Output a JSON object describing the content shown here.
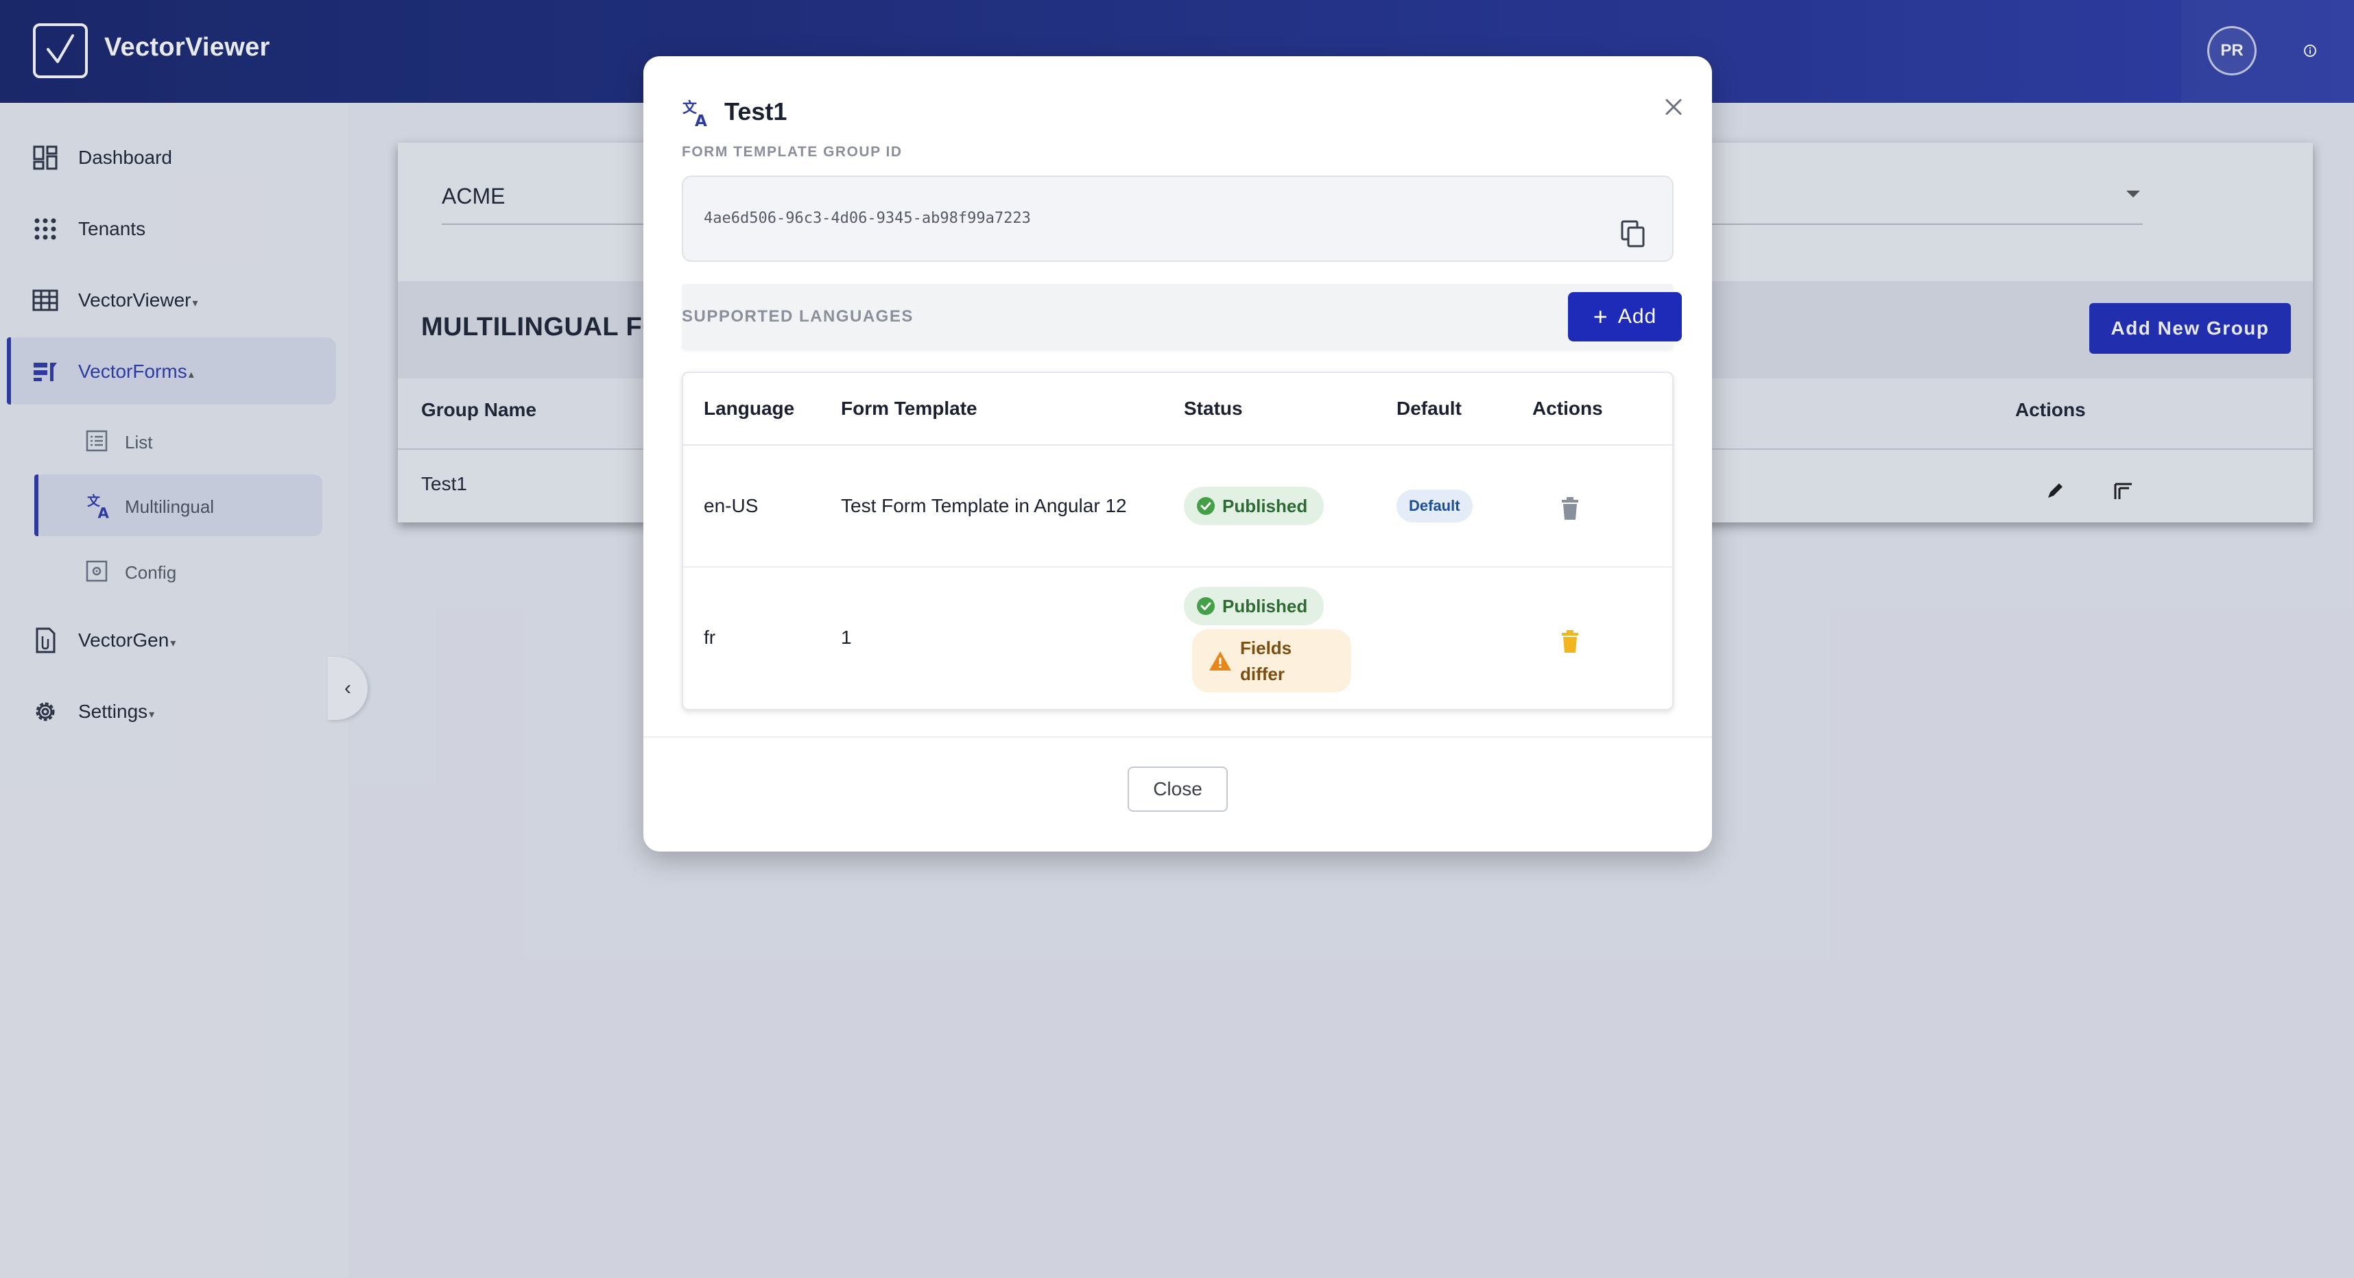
{
  "app": {
    "title": "VectorViewer"
  },
  "header": {
    "avatar_initials": "PR"
  },
  "sidebar": {
    "items": [
      {
        "label": "Dashboard",
        "icon": "dashboard-icon"
      },
      {
        "label": "Tenants",
        "icon": "grid-dots-icon"
      },
      {
        "label": "VectorViewer",
        "icon": "table-icon",
        "caret": "▾"
      },
      {
        "label": "VectorForms",
        "icon": "forms-icon",
        "caret": "▴",
        "active": true
      },
      {
        "label": "VectorGen",
        "icon": "document-icon",
        "caret": "▾"
      },
      {
        "label": "Settings",
        "icon": "gear-icon",
        "caret": "▾"
      }
    ],
    "sub_items": [
      {
        "label": "List",
        "icon": "list-icon"
      },
      {
        "label": "Multilingual",
        "icon": "translate-icon",
        "active": true
      },
      {
        "label": "Config",
        "icon": "config-icon"
      }
    ],
    "collapse_icon": "chevron-left-icon"
  },
  "background": {
    "tenant_value": "ACME",
    "section_title": "MULTILINGUAL FORM TEMPLATE GROUPS",
    "add_group_label": "Add New Group",
    "columns": {
      "group_name": "Group Name",
      "actions": "Actions"
    },
    "rows": [
      {
        "group_name": "Test1"
      }
    ]
  },
  "modal": {
    "title": "Test1",
    "id_label": "FORM TEMPLATE GROUP ID",
    "id_value": "4ae6d506-96c3-4d06-9345-ab98f99a7223",
    "languages_label": "SUPPORTED LANGUAGES",
    "add_label": "Add",
    "table": {
      "headers": [
        "Language",
        "Form Template",
        "Status",
        "Default",
        "Actions"
      ],
      "rows": [
        {
          "language": "en-US",
          "template": "Test Form Template in Angular 12",
          "status": "Published",
          "default": "Default"
        },
        {
          "language": "fr",
          "template": "1",
          "status": "Published",
          "warning_line1": "Fields",
          "warning_line2": "differ"
        }
      ]
    },
    "close_label": "Close"
  },
  "colors": {
    "header_start": "#16246a",
    "header_end": "#2c3aa8",
    "primary_button": "#1e2bb8",
    "published_bg": "#e3f1e4",
    "published_fg": "#2e6b33",
    "warning_bg": "#fdf0dc",
    "warning_icon": "#e8861a",
    "trash_warning": "#f2b51d"
  }
}
